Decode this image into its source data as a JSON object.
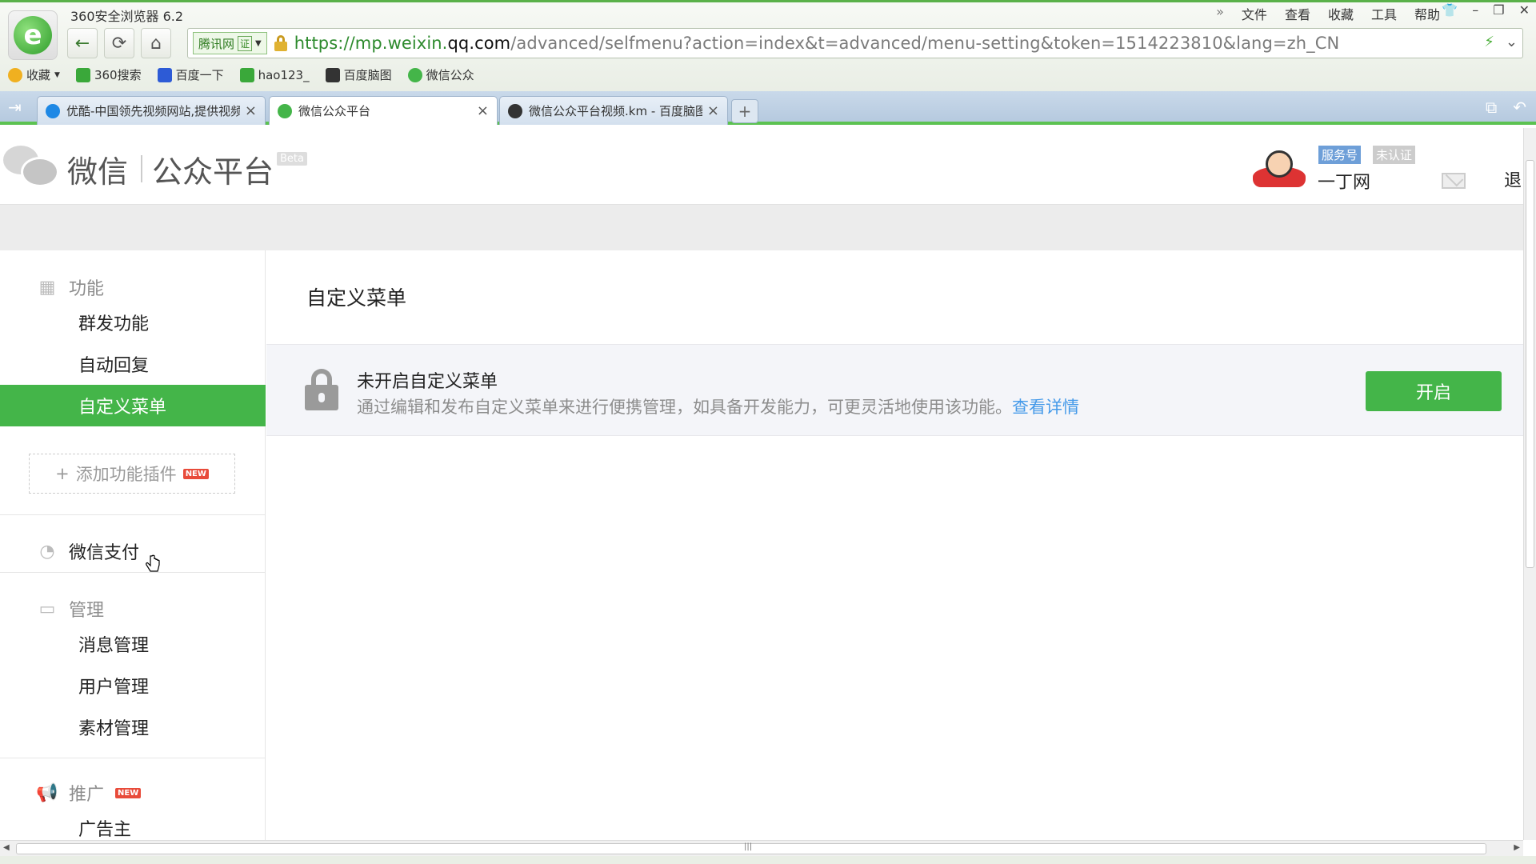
{
  "browser": {
    "title": "360安全浏览器 6.2",
    "menu": [
      "文件",
      "查看",
      "收藏",
      "工具",
      "帮助"
    ],
    "site_badge": "腾讯网",
    "site_badge_cert": "证",
    "url_scheme": "https://mp.weixin.",
    "url_host": "qq.com",
    "url_path": "/advanced/selfmenu?action=index&t=advanced/menu-setting&token=1514223810&lang=zh_CN",
    "bookmarks": [
      {
        "label": "收藏",
        "icon": "star-icon",
        "color": "#f0b020"
      },
      {
        "label": "360搜索",
        "icon": "search-icon",
        "color": "#3aa83a"
      },
      {
        "label": "百度一下",
        "icon": "baidu-icon",
        "color": "#2d5bd6"
      },
      {
        "label": "hao123_",
        "icon": "hao123-icon",
        "color": "#3aa83a"
      },
      {
        "label": "百度脑图",
        "icon": "owl-icon",
        "color": "#333333"
      },
      {
        "label": "微信公众",
        "icon": "wechat-icon",
        "color": "#44b549"
      }
    ],
    "tabs": [
      {
        "label": "优酷-中国领先视频网站,提供视频",
        "icon": "youku-icon",
        "color": "#1e88e5"
      },
      {
        "label": "微信公众平台",
        "icon": "wechat-icon",
        "color": "#44b549"
      },
      {
        "label": "微信公众平台视频.km - 百度脑图",
        "icon": "owl-icon",
        "color": "#333333"
      }
    ],
    "new_tab": "+"
  },
  "header": {
    "brand": "微信",
    "platform": "公众平台",
    "beta": "Beta",
    "badge_service": "服务号",
    "badge_unverified": "未认证",
    "account_name": "一丁网",
    "logout": "退"
  },
  "sidebar": {
    "groups": [
      {
        "label": "功能",
        "icon": "grid-icon",
        "items": [
          "群发功能",
          "自动回复",
          "自定义菜单"
        ]
      },
      {
        "label": "微信支付",
        "icon": "wallet-icon",
        "items": []
      },
      {
        "label": "管理",
        "icon": "inbox-icon",
        "items": [
          "消息管理",
          "用户管理",
          "素材管理"
        ]
      },
      {
        "label": "推广",
        "icon": "megaphone-icon",
        "items": [
          "广告主"
        ]
      }
    ],
    "add_plugin": "添加功能插件",
    "new_badge": "NEW",
    "active_item": "自定义菜单"
  },
  "main": {
    "title": "自定义菜单",
    "notice_title": "未开启自定义菜单",
    "notice_desc": "通过编辑和发布自定义菜单来进行便携管理，如具备开发能力，可更灵活地使用该功能。",
    "notice_link": "查看详情",
    "enable_button": "开启"
  },
  "colors": {
    "accent": "#44b549",
    "link": "#459ae9"
  }
}
